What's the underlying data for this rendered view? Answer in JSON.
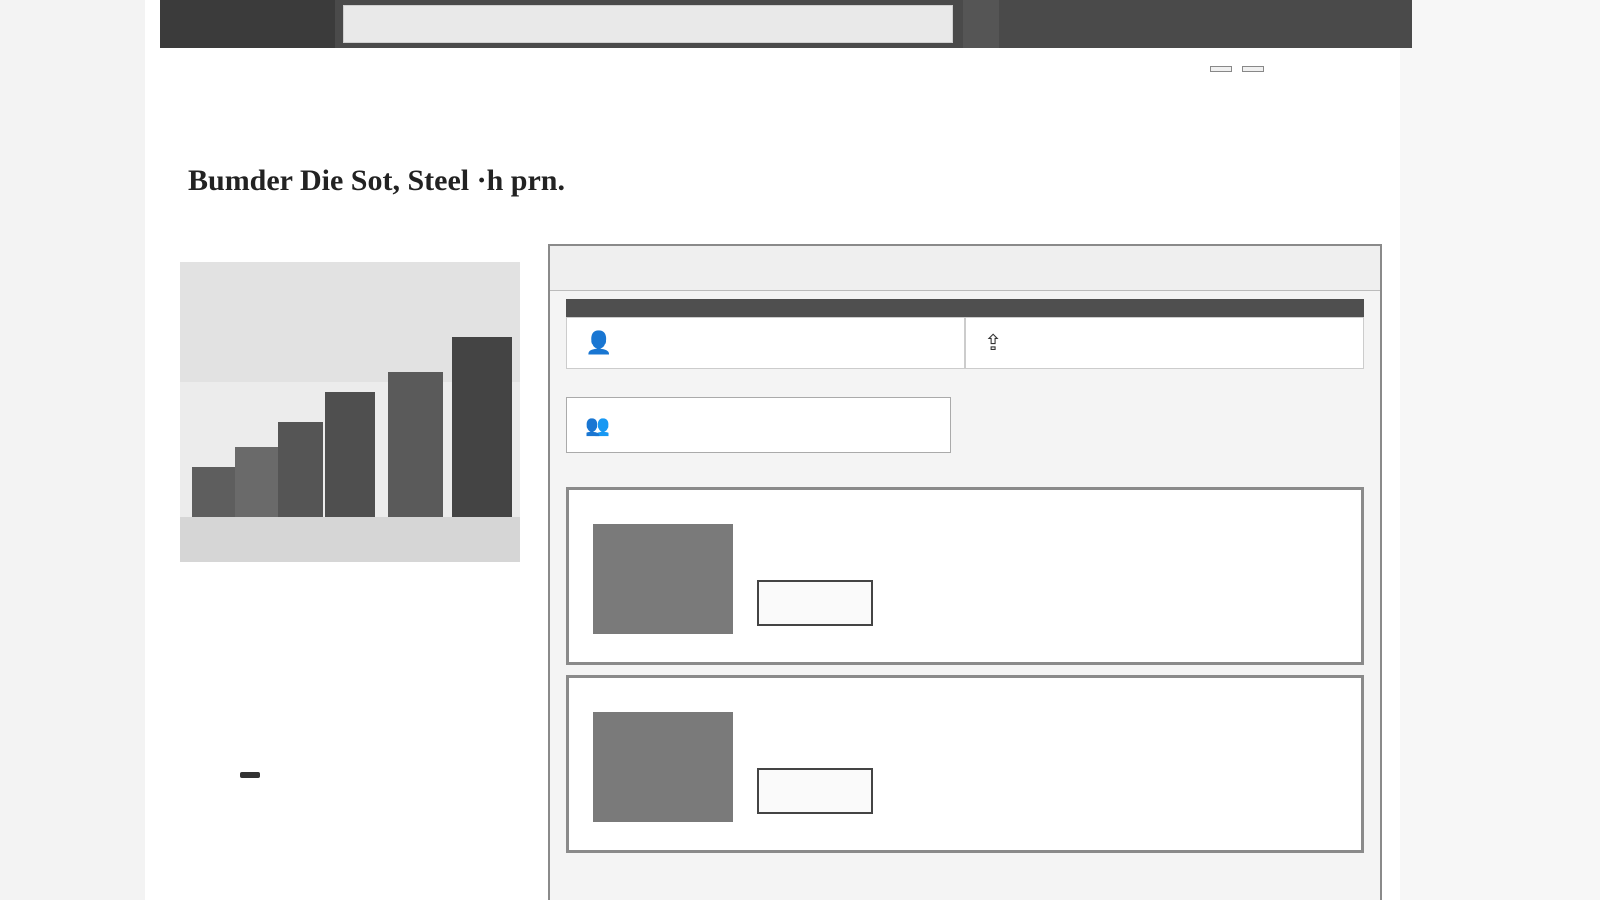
{
  "nav": {
    "search_placeholder": "",
    "links": [
      {
        "label": ""
      },
      {
        "label": ""
      },
      {
        "label": ""
      },
      {
        "label": ""
      }
    ]
  },
  "utility": {
    "left": "",
    "right": ""
  },
  "breadcrumb": "",
  "page": {
    "title": "Bumder Die Sot, Steel ·h prn.",
    "subtitle": ""
  },
  "left": {
    "image_caption": "",
    "info_rows": [
      {
        "a": "",
        "b": ""
      },
      {
        "a": "",
        "b": ""
      },
      {
        "a": "",
        "b": ""
      },
      {
        "a": "",
        "b": ""
      },
      {
        "a": "",
        "b": ""
      }
    ],
    "button": ""
  },
  "panel": {
    "title": "",
    "tabs": [
      {
        "icon": "person-icon",
        "label": ""
      },
      {
        "icon": "upload-icon",
        "label": ""
      }
    ],
    "option": {
      "icon": "person-group-icon",
      "label": ""
    },
    "section_label": "",
    "results": [
      {
        "name": "",
        "desc": "",
        "meta1": "",
        "meta2": "",
        "button": ""
      },
      {
        "name": "",
        "desc": "",
        "meta1": "",
        "meta2": "",
        "button": ""
      }
    ]
  }
}
